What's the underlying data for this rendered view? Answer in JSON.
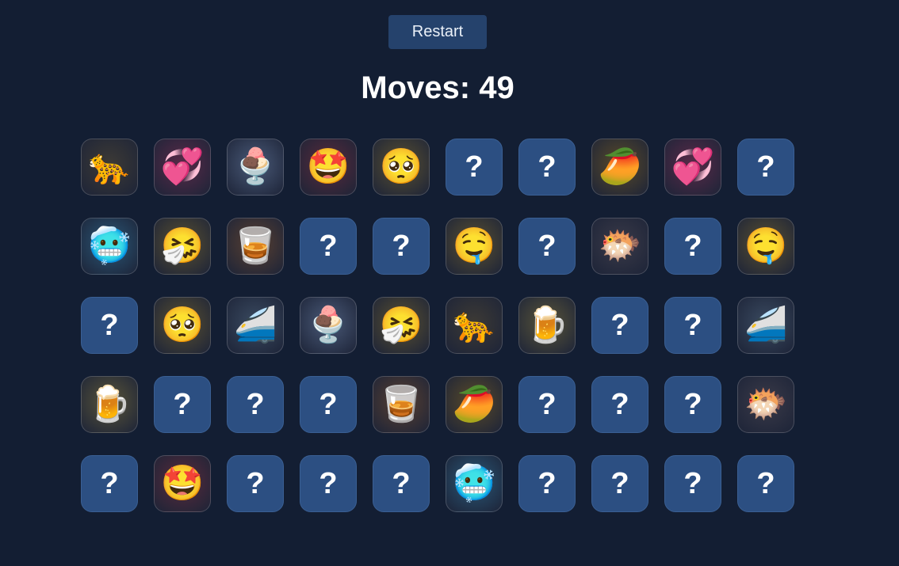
{
  "header": {
    "restart_label": "Restart",
    "moves_label": "Moves: 49"
  },
  "colors": {
    "background": "#131e33",
    "card_hidden": "#2c4f82",
    "button": "#25426c"
  },
  "board": {
    "hidden_symbol": "?",
    "cards": [
      {
        "state": "revealed",
        "emoji": "🐆",
        "icon": "leopard-icon",
        "tint": "#3d3a35"
      },
      {
        "state": "revealed",
        "emoji": "💞",
        "icon": "revolving-hearts-icon",
        "tint": "#5a2a48"
      },
      {
        "state": "revealed",
        "emoji": "🍨",
        "icon": "ice-cream-icon",
        "tint": "#4a5a78"
      },
      {
        "state": "revealed",
        "emoji": "🤩",
        "icon": "star-struck-icon",
        "tint": "#5a2a3a"
      },
      {
        "state": "revealed",
        "emoji": "🥺",
        "icon": "pleading-face-icon",
        "tint": "#5a5030"
      },
      {
        "state": "hidden"
      },
      {
        "state": "hidden"
      },
      {
        "state": "revealed",
        "emoji": "🥭",
        "icon": "mango-icon",
        "tint": "#5a4a28"
      },
      {
        "state": "revealed",
        "emoji": "💞",
        "icon": "revolving-hearts-icon",
        "tint": "#5a2a48"
      },
      {
        "state": "hidden"
      },
      {
        "state": "revealed",
        "emoji": "🥶",
        "icon": "cold-face-icon",
        "tint": "#2a5878"
      },
      {
        "state": "revealed",
        "emoji": "🤧",
        "icon": "sneezing-face-icon",
        "tint": "#5a5030"
      },
      {
        "state": "revealed",
        "emoji": "🥃",
        "icon": "tumbler-glass-icon",
        "tint": "#5a4030"
      },
      {
        "state": "hidden"
      },
      {
        "state": "hidden"
      },
      {
        "state": "revealed",
        "emoji": "🤤",
        "icon": "drooling-face-icon",
        "tint": "#5a5030"
      },
      {
        "state": "hidden"
      },
      {
        "state": "revealed",
        "emoji": "🐡",
        "icon": "blowfish-icon",
        "tint": "#3a3a48"
      },
      {
        "state": "hidden"
      },
      {
        "state": "revealed",
        "emoji": "🤤",
        "icon": "drooling-face-icon",
        "tint": "#5a5030"
      },
      {
        "state": "hidden"
      },
      {
        "state": "revealed",
        "emoji": "🥺",
        "icon": "pleading-face-icon",
        "tint": "#5a5030"
      },
      {
        "state": "revealed",
        "emoji": "🚄",
        "icon": "high-speed-train-icon",
        "tint": "#3a4a60"
      },
      {
        "state": "revealed",
        "emoji": "🍨",
        "icon": "ice-cream-icon",
        "tint": "#4a5a78"
      },
      {
        "state": "revealed",
        "emoji": "🤧",
        "icon": "sneezing-face-icon",
        "tint": "#5a5030"
      },
      {
        "state": "revealed",
        "emoji": "🐆",
        "icon": "leopard-icon",
        "tint": "#3d3a35"
      },
      {
        "state": "revealed",
        "emoji": "🍺",
        "icon": "beer-mug-icon",
        "tint": "#5a5538"
      },
      {
        "state": "hidden"
      },
      {
        "state": "hidden"
      },
      {
        "state": "revealed",
        "emoji": "🚄",
        "icon": "high-speed-train-icon",
        "tint": "#3a4a60"
      },
      {
        "state": "revealed",
        "emoji": "🍺",
        "icon": "beer-mug-icon",
        "tint": "#5a5538"
      },
      {
        "state": "hidden"
      },
      {
        "state": "hidden"
      },
      {
        "state": "hidden"
      },
      {
        "state": "revealed",
        "emoji": "🥃",
        "icon": "tumbler-glass-icon",
        "tint": "#5a4030"
      },
      {
        "state": "revealed",
        "emoji": "🥭",
        "icon": "mango-icon",
        "tint": "#5a4a28"
      },
      {
        "state": "hidden"
      },
      {
        "state": "hidden"
      },
      {
        "state": "hidden"
      },
      {
        "state": "revealed",
        "emoji": "🐡",
        "icon": "blowfish-icon",
        "tint": "#3a3a48"
      },
      {
        "state": "hidden"
      },
      {
        "state": "revealed",
        "emoji": "🤩",
        "icon": "star-struck-icon",
        "tint": "#5a2a3a"
      },
      {
        "state": "hidden"
      },
      {
        "state": "hidden"
      },
      {
        "state": "hidden"
      },
      {
        "state": "revealed",
        "emoji": "🥶",
        "icon": "cold-face-icon",
        "tint": "#2a5878"
      },
      {
        "state": "hidden"
      },
      {
        "state": "hidden"
      },
      {
        "state": "hidden"
      },
      {
        "state": "hidden"
      }
    ]
  }
}
